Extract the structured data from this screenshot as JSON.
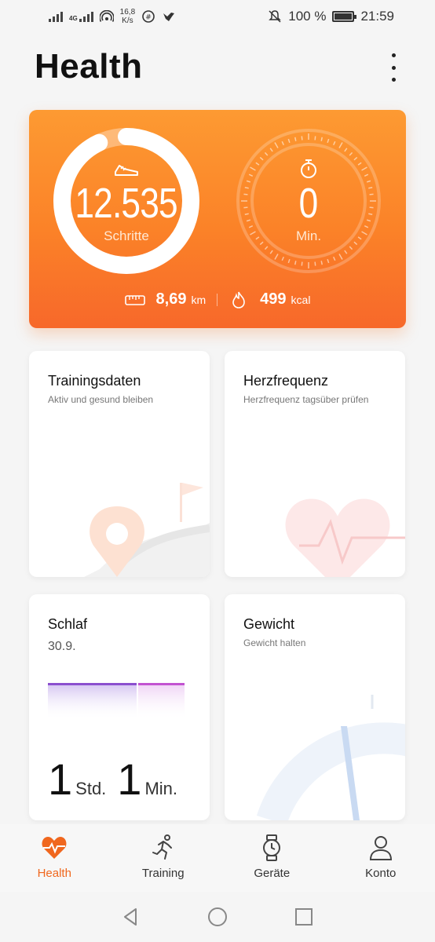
{
  "status_bar": {
    "network_label": "4G",
    "speed_value": "16,8",
    "speed_unit": "K/s",
    "battery": "100 %",
    "time": "21:59",
    "icons": [
      "signal-icon",
      "signal-4g-icon",
      "hotspot-icon",
      "data-saver-icon",
      "bird-icon",
      "mute-icon",
      "battery-icon"
    ]
  },
  "header": {
    "title": "Health",
    "menu_icon": "more-vertical-icon"
  },
  "activity": {
    "steps_value": "12.535",
    "steps_label": "Schritte",
    "steps_progress": 0.93,
    "minutes_value": "0",
    "minutes_label": "Min.",
    "distance_value": "8,69",
    "distance_unit": "km",
    "calories_value": "499",
    "calories_unit": "kcal",
    "colors": {
      "gradient_top": "#fd9a32",
      "gradient_bottom": "#f7682a"
    }
  },
  "cards": {
    "training": {
      "title": "Trainingsdaten",
      "subtitle": "Aktiv und gesund bleiben"
    },
    "heart": {
      "title": "Herzfrequenz",
      "subtitle": "Herzfrequenz tagsüber prüfen"
    },
    "sleep": {
      "title": "Schlaf",
      "date": "30.9.",
      "hours": "1",
      "hours_unit": "Std.",
      "minutes": "1",
      "minutes_unit": "Min."
    },
    "weight": {
      "title": "Gewicht",
      "subtitle": "Gewicht halten"
    }
  },
  "bottom_nav": {
    "items": [
      {
        "label": "Health",
        "icon": "heart-pulse-icon",
        "active": true
      },
      {
        "label": "Training",
        "icon": "runner-icon",
        "active": false
      },
      {
        "label": "Geräte",
        "icon": "watch-icon",
        "active": false
      },
      {
        "label": "Konto",
        "icon": "person-icon",
        "active": false
      }
    ],
    "accent": "#f0671e"
  },
  "system_nav": {
    "icons": [
      "back-icon",
      "home-icon",
      "recents-icon"
    ]
  }
}
